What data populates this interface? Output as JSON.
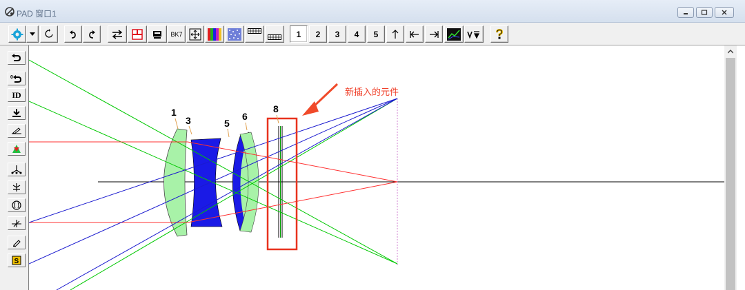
{
  "window": {
    "title": "PAD 窗口1"
  },
  "toolbar": {
    "buttons": [
      {
        "name": "settings-gear-icon"
      },
      {
        "name": "dropdown-arrow-icon"
      },
      {
        "name": "refresh-icon"
      },
      {
        "name": "undo-icon"
      },
      {
        "name": "redo-icon"
      },
      {
        "name": "swap-arrows-icon"
      },
      {
        "name": "layout-grid-icon"
      },
      {
        "name": "display-icon"
      },
      {
        "name": "glass-catalog-icon",
        "label": "BK7"
      },
      {
        "name": "fit-view-icon"
      },
      {
        "name": "color-bars-icon"
      },
      {
        "name": "spot-diagram-icon"
      },
      {
        "name": "table-icon"
      },
      {
        "name": "table-alt-icon"
      }
    ],
    "zoom_buttons": [
      "1",
      "2",
      "3",
      "4",
      "5"
    ],
    "nav_buttons": [
      {
        "name": "arrow-up-icon"
      },
      {
        "name": "first-surface-icon"
      },
      {
        "name": "last-surface-icon"
      },
      {
        "name": "chart-icon"
      },
      {
        "name": "vector-icon"
      },
      {
        "name": "help-icon"
      }
    ]
  },
  "sidebar": {
    "buttons": [
      {
        "name": "undo-side-icon"
      },
      {
        "name": "undo-zero-icon"
      },
      {
        "name": "id-button",
        "label": "ID"
      },
      {
        "name": "download-icon"
      },
      {
        "name": "edit-pen-icon"
      },
      {
        "name": "insert-element-icon"
      },
      {
        "name": "weight-icon"
      },
      {
        "name": "fork-icon"
      },
      {
        "name": "lens-icon"
      },
      {
        "name": "plane-icon"
      },
      {
        "name": "pencil-icon"
      },
      {
        "name": "save-icon"
      }
    ]
  },
  "diagram": {
    "surface_labels": [
      "1",
      "3",
      "5",
      "6",
      "8"
    ],
    "annotation": "新插入的元件",
    "colors": {
      "ray_green": "#00c800",
      "ray_red": "#ff3030",
      "ray_blue": "#1a1acf",
      "lens_green": "#a8f2a8",
      "lens_blue": "#1a1ae6",
      "highlight_box": "#e8321e",
      "annotation_text": "#f0402a",
      "axis": "#000000",
      "image_plane": "#d080d0"
    }
  }
}
